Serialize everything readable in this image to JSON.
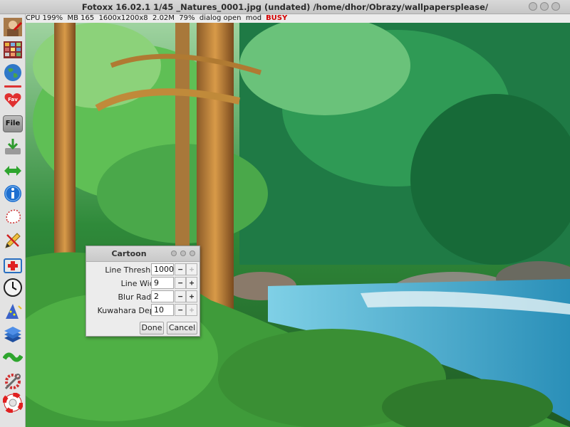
{
  "window": {
    "title": "Fotoxx 16.02.1  1/45  _Natures_0001.jpg  (undated)  /home/dhor/Obrazy/wallpapersplease/"
  },
  "status": {
    "text": "CPU 199%  MB 165  1600x1200x8  2.02M  79%  dialog open  mod",
    "busy": "BUSY",
    "busy_color": "#d40000"
  },
  "toolbar": {
    "items": [
      {
        "icon": "user-avatar-icon"
      },
      {
        "icon": "gallery-icon"
      },
      {
        "icon": "globe-icon"
      },
      {
        "icon": "favorites-heart-icon",
        "label": "Fav"
      },
      {
        "icon": "file-menu-icon",
        "label": "File"
      },
      {
        "icon": "save-download-icon"
      },
      {
        "icon": "navigate-arrows-icon"
      },
      {
        "icon": "info-icon"
      },
      {
        "icon": "select-area-icon"
      },
      {
        "icon": "edit-pencil-icon"
      },
      {
        "icon": "repair-kit-icon"
      },
      {
        "icon": "clock-icon"
      },
      {
        "icon": "wizard-effects-icon"
      },
      {
        "icon": "layers-icon"
      },
      {
        "icon": "warp-icon"
      },
      {
        "icon": "tools-icon"
      },
      {
        "icon": "help-lifebuoy-icon"
      }
    ]
  },
  "dialog": {
    "title": "Cartoon",
    "fields": [
      {
        "label": "Line Threshold",
        "value": "1000",
        "minus_enabled": true,
        "plus_enabled": false
      },
      {
        "label": "Line Width",
        "value": "9",
        "minus_enabled": true,
        "plus_enabled": true
      },
      {
        "label": "Blur Radius",
        "value": "2",
        "minus_enabled": true,
        "plus_enabled": true
      },
      {
        "label": "Kuwahara Depth",
        "value": "10",
        "minus_enabled": true,
        "plus_enabled": false
      }
    ],
    "done_label": "Done",
    "cancel_label": "Cancel"
  }
}
